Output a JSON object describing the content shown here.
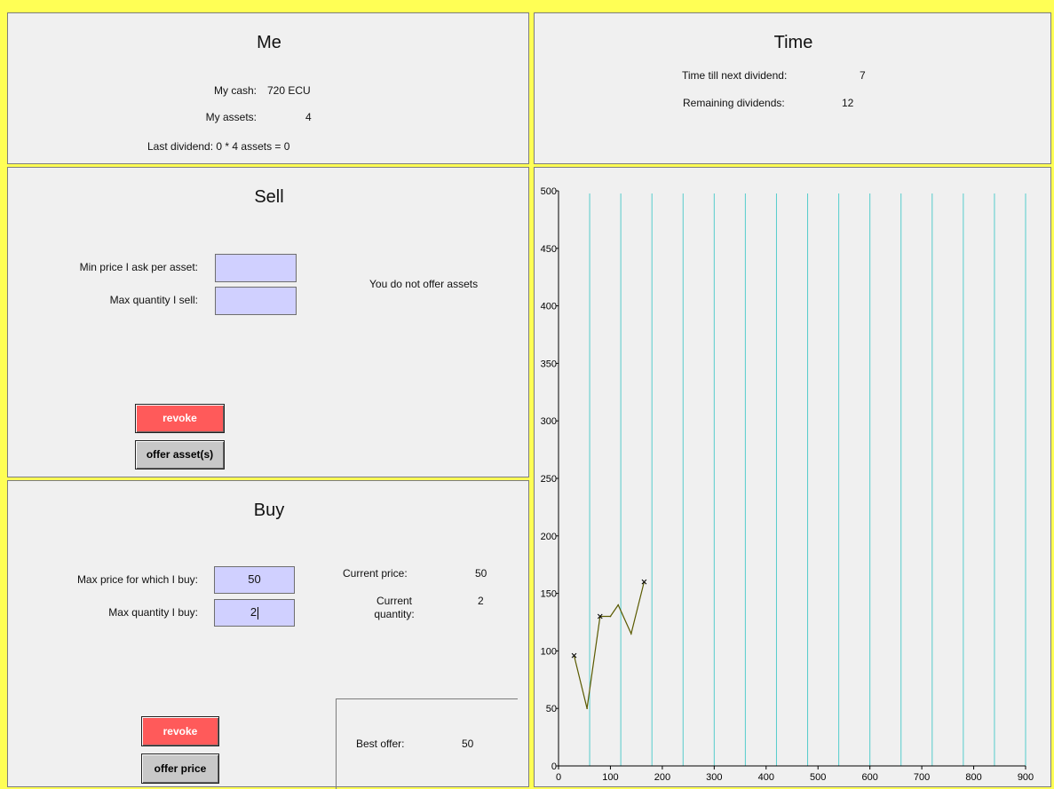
{
  "me": {
    "title": "Me",
    "cash_label": "My cash:",
    "cash_value": "720 ECU",
    "assets_label": "My assets:",
    "assets_value": "4",
    "last_dividend": "Last dividend: 0 * 4 assets = 0"
  },
  "time": {
    "title": "Time",
    "next_dividend_label": "Time till next dividend:",
    "next_dividend_value": "7",
    "remaining_label": "Remaining dividends:",
    "remaining_value": "12"
  },
  "sell": {
    "title": "Sell",
    "min_price_label": "Min price I ask per asset:",
    "min_price_value": "",
    "max_qty_label": "Max quantity I sell:",
    "max_qty_value": "",
    "status": "You do not offer assets",
    "revoke_label": "revoke",
    "offer_label": "offer asset(s)"
  },
  "buy": {
    "title": "Buy",
    "max_price_label": "Max price for which I buy:",
    "max_price_value": "50",
    "max_qty_label": "Max quantity I buy:",
    "max_qty_value": "2",
    "current_price_label": "Current price:",
    "current_price_value": "50",
    "current_qty_label": "Current quantity:",
    "current_qty_value": "2",
    "best_offer_label": "Best offer:",
    "best_offer_value": "50",
    "revoke_label": "revoke",
    "offer_label": "offer price"
  },
  "chart_data": {
    "type": "line",
    "x_ticks": [
      "0",
      "100",
      "200",
      "300",
      "400",
      "500",
      "600",
      "700",
      "800",
      "900"
    ],
    "y_ticks": [
      "0",
      "50",
      "100",
      "150",
      "200",
      "250",
      "300",
      "350",
      "400",
      "450",
      "500"
    ],
    "xlim": [
      0,
      900
    ],
    "ylim": [
      0,
      500
    ],
    "period_lines": [
      60,
      120,
      180,
      240,
      300,
      360,
      420,
      480,
      540,
      600,
      660,
      720,
      780,
      840,
      900
    ],
    "period_line_color": "#55cccc",
    "line_color": "#5a5a00",
    "points": [
      {
        "x": 30,
        "y": 96
      },
      {
        "x": 55,
        "y": 50
      },
      {
        "x": 80,
        "y": 130
      },
      {
        "x": 100,
        "y": 130
      },
      {
        "x": 115,
        "y": 140
      },
      {
        "x": 140,
        "y": 115
      },
      {
        "x": 165,
        "y": 160
      }
    ],
    "markers_at": [
      0,
      2,
      6
    ]
  }
}
